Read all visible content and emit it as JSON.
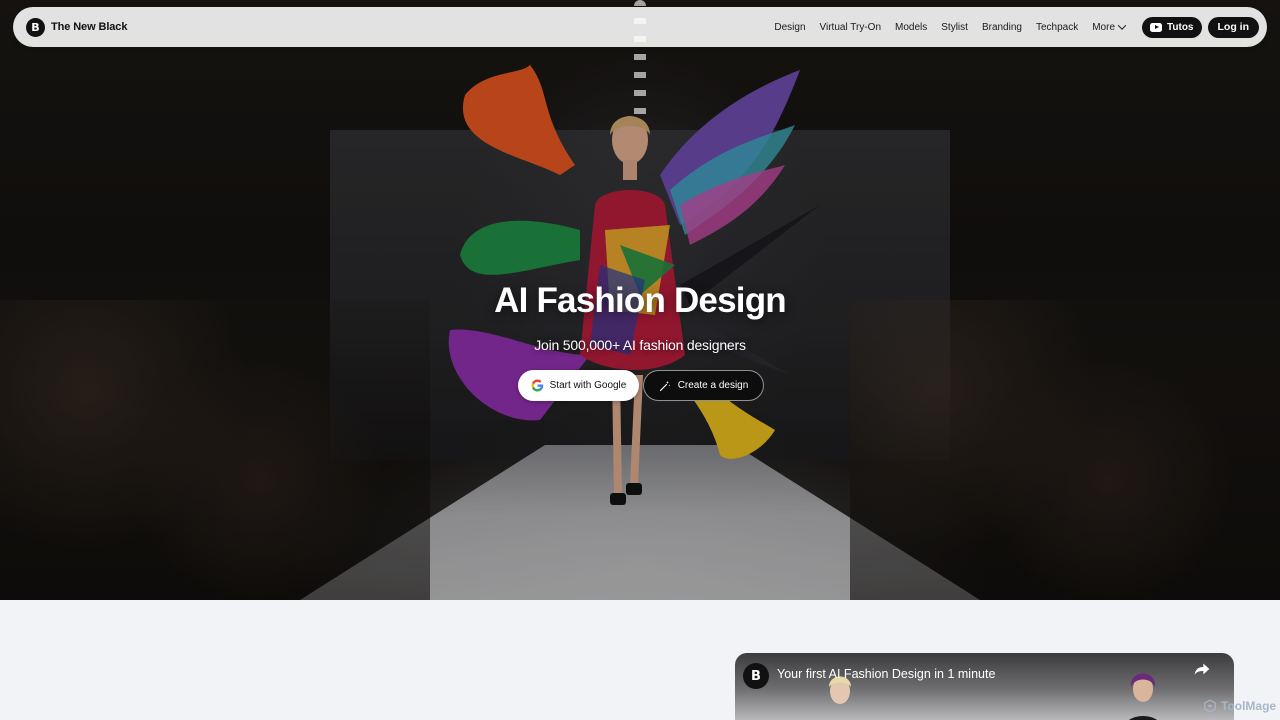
{
  "nav": {
    "brand_name": "The New Black",
    "brand_logo_letter": "B",
    "links": [
      "Design",
      "Virtual Try-On",
      "Models",
      "Stylist",
      "Branding",
      "Techpack"
    ],
    "more_label": "More",
    "tutos_label": "Tutos",
    "login_label": "Log in"
  },
  "hero": {
    "title": "AI Fashion Design",
    "subtitle": "Join 500,000+ AI fashion designers",
    "google_button": "Start with Google",
    "create_button": "Create a design"
  },
  "video": {
    "logo_letter": "B",
    "title": "Your first AI Fashion Design in 1 minute"
  },
  "watermark": {
    "label": "ToolMage"
  },
  "colors": {
    "page_background": "#f1f3f7",
    "button_dark": "#111111",
    "button_light": "#ffffff"
  },
  "icons": [
    "youtube-icon",
    "chevron-down-icon",
    "google-icon",
    "magic-wand-icon",
    "share-icon"
  ]
}
